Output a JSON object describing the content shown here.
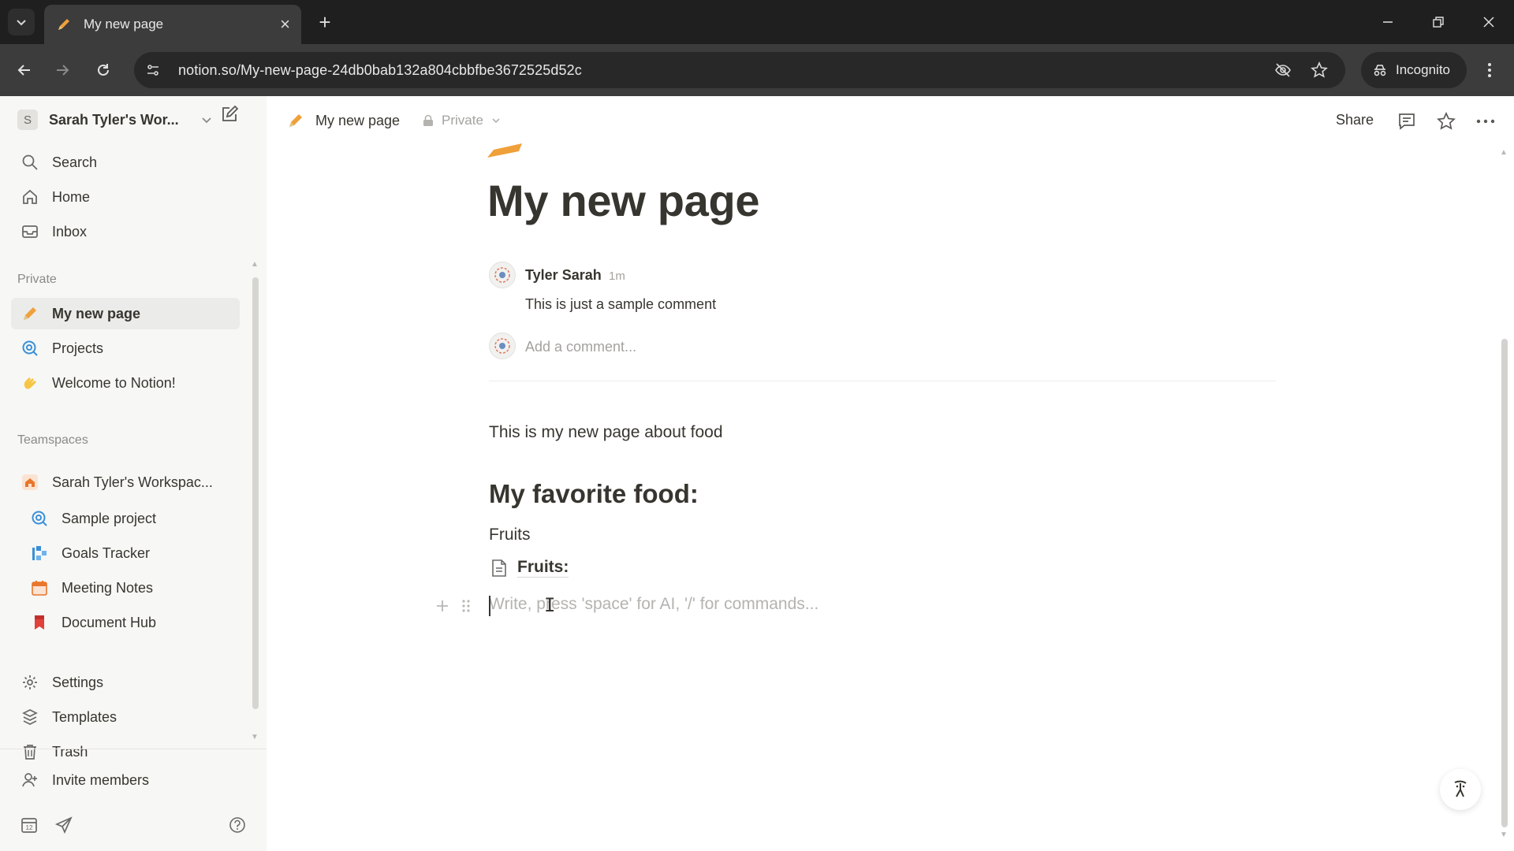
{
  "browser": {
    "tab_title": "My new page",
    "url": "notion.so/My-new-page-24db0bab132a804cbbfbe3672525d52c",
    "incognito_label": "Incognito"
  },
  "sidebar": {
    "workspace_initial": "S",
    "workspace_name": "Sarah Tyler's Wor...",
    "top_items": [
      {
        "label": "Search",
        "icon": "search-icon"
      },
      {
        "label": "Home",
        "icon": "home-icon"
      },
      {
        "label": "Inbox",
        "icon": "inbox-icon"
      }
    ],
    "private_label": "Private",
    "private_items": [
      {
        "label": "My new page",
        "icon": "pencil-icon"
      },
      {
        "label": "Projects",
        "icon": "target-icon"
      },
      {
        "label": "Welcome to Notion!",
        "icon": "wave-icon"
      }
    ],
    "teamspaces_label": "Teamspaces",
    "teamspace_name": "Sarah Tyler's Workspac...",
    "teamspace_items": [
      {
        "label": "Sample project",
        "icon": "target-icon"
      },
      {
        "label": "Goals Tracker",
        "icon": "goals-icon"
      },
      {
        "label": "Meeting Notes",
        "icon": "calendar-icon"
      },
      {
        "label": "Document Hub",
        "icon": "bookmark-icon"
      }
    ],
    "footer_items": [
      {
        "label": "Settings",
        "icon": "gear-icon"
      },
      {
        "label": "Templates",
        "icon": "templates-icon"
      },
      {
        "label": "Trash",
        "icon": "trash-icon"
      }
    ],
    "invite_label": "Invite members"
  },
  "topbar": {
    "breadcrumb": "My new page",
    "privacy": "Private",
    "share_label": "Share"
  },
  "page": {
    "title": "My new page",
    "comment": {
      "author": "Tyler Sarah",
      "time": "1m",
      "text": "This is just a sample comment",
      "add_placeholder": "Add a comment..."
    },
    "paragraph": "This is my new page about food",
    "heading": "My favorite food:",
    "fruits_text": "Fruits",
    "subpage_label": "Fruits:",
    "block_placeholder": "Write, press 'space' for AI, '/' for commands..."
  },
  "colors": {
    "accent_orange": "#e88a2c",
    "sidebar_bg": "#f7f7f5",
    "text": "#37352f"
  }
}
